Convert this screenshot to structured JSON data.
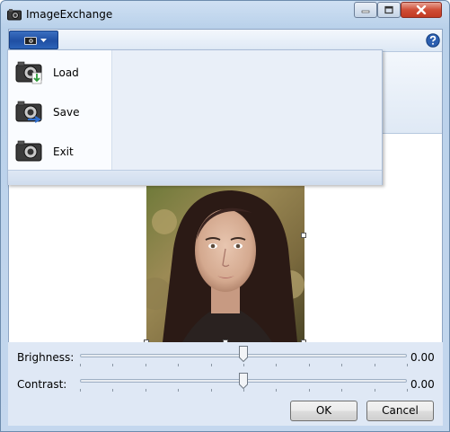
{
  "window": {
    "title": "ImageExchange"
  },
  "menu": {
    "items": [
      {
        "label": "Load",
        "icon": "camera-load-icon"
      },
      {
        "label": "Save",
        "icon": "camera-save-icon"
      },
      {
        "label": "Exit",
        "icon": "camera-icon"
      }
    ]
  },
  "controls": {
    "brightness_label": "Brighness:",
    "brightness_value": "0.00",
    "brightness_level": 0.5,
    "contrast_label": "Contrast:",
    "contrast_value": "0.00",
    "contrast_level": 0.5
  },
  "buttons": {
    "ok": "OK",
    "cancel": "Cancel"
  },
  "colors": {
    "accent": "#1f4fa3",
    "close": "#c23a22"
  }
}
